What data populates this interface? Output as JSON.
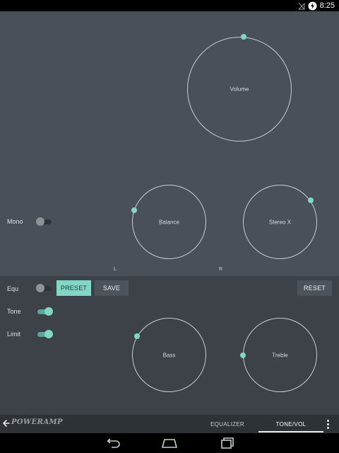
{
  "status_bar": {
    "time": "8:25",
    "icons": [
      "no-sim-icon",
      "battery-charging-icon"
    ]
  },
  "knobs": {
    "volume": {
      "label": "Volume",
      "indicator_angle_deg": 5
    },
    "balance": {
      "label": "Balance",
      "indicator_angle_deg": -72,
      "left_label": "L",
      "right_label": "R"
    },
    "stereo_x": {
      "label": "Stereo X",
      "indicator_angle_deg": 55
    },
    "bass": {
      "label": "Bass",
      "indicator_angle_deg": -60
    },
    "treble": {
      "label": "Treble",
      "indicator_angle_deg": -90
    }
  },
  "toggles": {
    "mono": {
      "label": "Mono",
      "on": false
    },
    "equ": {
      "label": "Equ",
      "on": false
    },
    "tone": {
      "label": "Tone",
      "on": true
    },
    "limit": {
      "label": "Limit",
      "on": true
    }
  },
  "buttons": {
    "preset": "PRESET",
    "save": "SAVE",
    "reset": "RESET"
  },
  "bottom_bar": {
    "logo": "POWERAMP",
    "tabs": [
      {
        "label": "EQUALIZER",
        "active": false
      },
      {
        "label": "TONE/VOL",
        "active": true
      }
    ],
    "icons": [
      "back-arrow-icon",
      "overflow-menu-icon"
    ]
  },
  "nav_bar": {
    "icons": [
      "nav-back-icon",
      "nav-home-icon",
      "nav-recents-icon"
    ]
  },
  "colors": {
    "accent": "#7fd8c3",
    "upper_panel": "#4a5057",
    "lower_panel": "#3c4248",
    "bottom_bar": "#2d3237"
  }
}
